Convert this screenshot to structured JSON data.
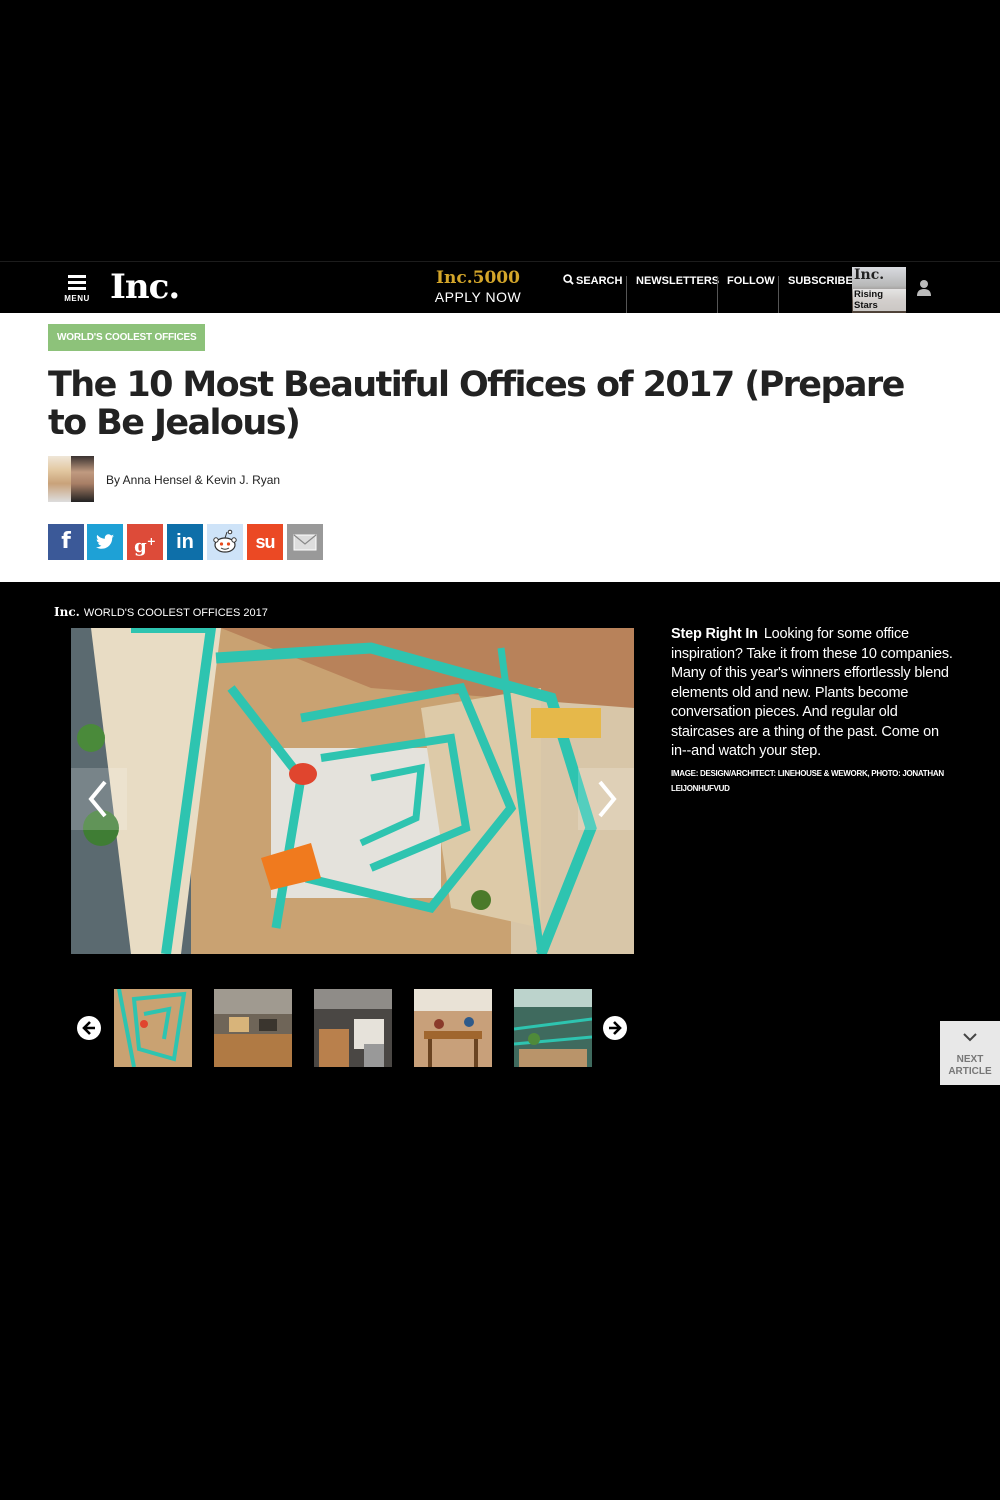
{
  "nav": {
    "menu_label": "MENU",
    "logo": "Inc.",
    "promo_title": "Inc.5000",
    "promo_cta": "APPLY NOW",
    "search": "SEARCH",
    "newsletters": "NEWSLETTERS",
    "follow": "FOLLOW",
    "subscribe": "SUBSCRIBE",
    "magazine_title": "Inc.",
    "magazine_cover_line": "Rising Stars"
  },
  "article": {
    "tag": "WORLD'S COOLEST OFFICES",
    "headline": "The 10 Most Beautiful Offices of 2017 (Prepare to Be Jealous)",
    "byline": "By Anna Hensel & Kevin J. Ryan"
  },
  "share": [
    {
      "name": "facebook",
      "glyph": "f",
      "color": "#3b5998"
    },
    {
      "name": "twitter",
      "glyph": "t",
      "color": "#1ea1d6"
    },
    {
      "name": "google-plus",
      "glyph": "g+",
      "color": "#dd4b39"
    },
    {
      "name": "linkedin",
      "glyph": "in",
      "color": "#0e6fa9"
    },
    {
      "name": "reddit",
      "glyph": "reddit",
      "color": "#cee3f8"
    },
    {
      "name": "stumbleupon",
      "glyph": "su",
      "color": "#eb4924"
    },
    {
      "name": "email",
      "glyph": "email",
      "color": "#999999"
    }
  ],
  "gallery": {
    "brand_logo": "Inc.",
    "brand_title": "WORLD'S COOLEST OFFICES 2017",
    "caption_title": "Step Right In",
    "caption_body": "Looking for some office inspiration? Take it from these 10 companies. Many of this year's winners effortlessly blend elements old and new. Plants become conversation pieces. And regular old staircases are a thing of the past. Come on in--and watch your step.",
    "credit": "IMAGE: DESIGN/ARCHITECT: LINEHOUSE & WEWORK, PHOTO: JONATHAN LEIJONHUFVUD"
  },
  "next_article": {
    "line1": "NEXT",
    "line2": "ARTICLE"
  },
  "colors": {
    "background": "#000000",
    "tag_green": "#8dc27a",
    "promo_gold": "#d4a62a",
    "stair_teal": "#2ec4b0"
  }
}
